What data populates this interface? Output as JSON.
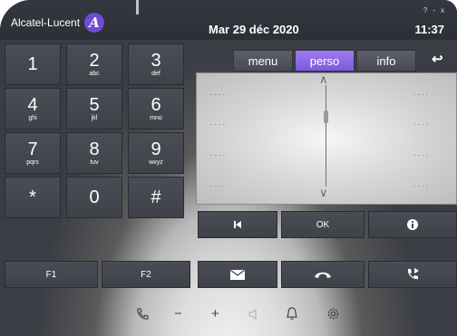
{
  "header": {
    "brand": "Alcatel-Lucent",
    "logo_glyph": "A",
    "date": "Mar 29 déc 2020",
    "time": "11:37",
    "help": "?",
    "minimize": "-",
    "close": "x"
  },
  "keypad": {
    "keys": [
      {
        "digit": "1",
        "letters": ""
      },
      {
        "digit": "2",
        "letters": "abc"
      },
      {
        "digit": "3",
        "letters": "def"
      },
      {
        "digit": "4",
        "letters": "ghi"
      },
      {
        "digit": "5",
        "letters": "jkl"
      },
      {
        "digit": "6",
        "letters": "mno"
      },
      {
        "digit": "7",
        "letters": "pqrs"
      },
      {
        "digit": "8",
        "letters": "tuv"
      },
      {
        "digit": "9",
        "letters": "wxyz"
      },
      {
        "digit": "*",
        "letters": ""
      },
      {
        "digit": "0",
        "letters": ""
      },
      {
        "digit": "#",
        "letters": ""
      }
    ],
    "function_keys": [
      "F1",
      "F2"
    ]
  },
  "tabs": {
    "items": [
      {
        "label": "menu"
      },
      {
        "label": "perso"
      },
      {
        "label": "info"
      }
    ],
    "active": "perso"
  },
  "display": {
    "placeholder": "....",
    "scroll_position": 0.3
  },
  "controls": {
    "ok_label": "OK",
    "buttons": [
      "skip-back-icon",
      "ok",
      "info-icon"
    ],
    "call_buttons": [
      "envelope-icon",
      "hang-up-icon",
      "call-forward-icon"
    ]
  },
  "footer": {
    "icons": [
      "phone-icon",
      "volume-down-icon",
      "volume-up-icon",
      "speaker-icon",
      "bell-icon",
      "gear-icon"
    ],
    "minus": "−",
    "plus": "+"
  },
  "colors": {
    "accent": "#8a67e6",
    "panel": "#3a3d44",
    "key": "#454850"
  }
}
